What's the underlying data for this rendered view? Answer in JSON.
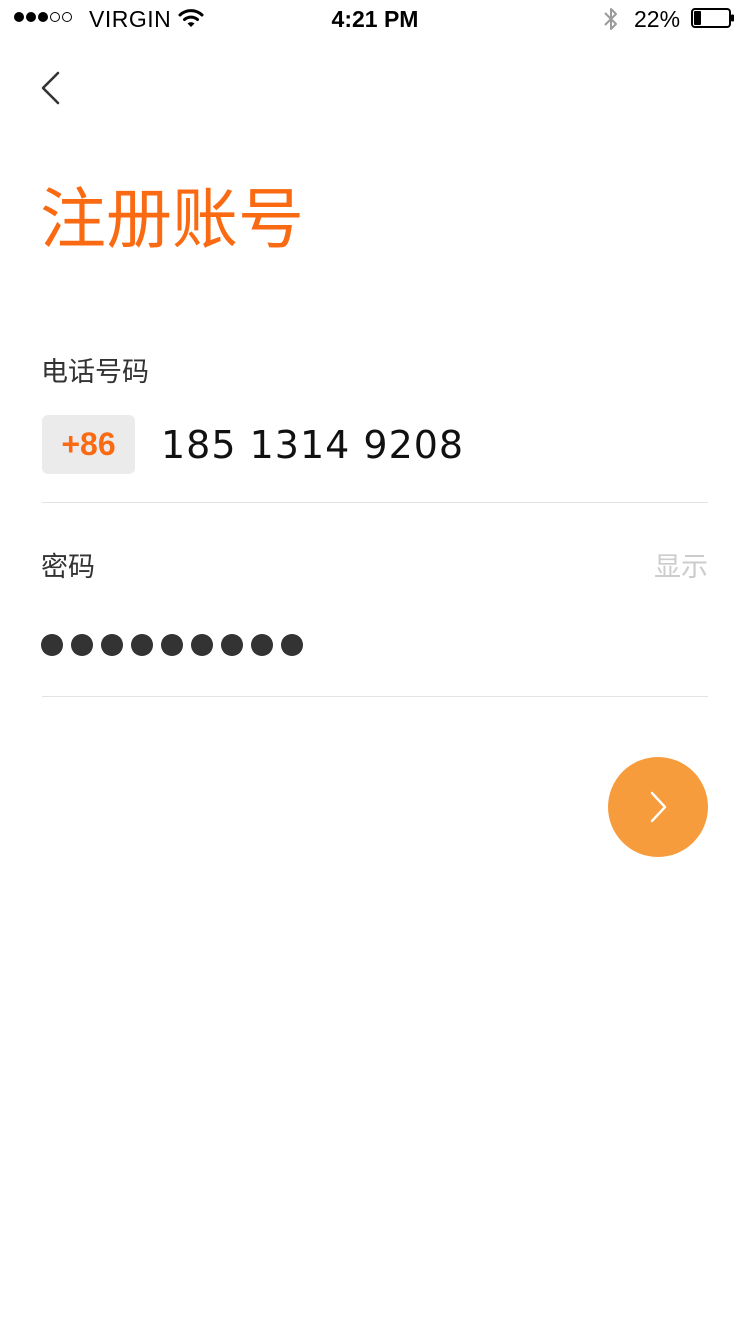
{
  "status_bar": {
    "signal_bars_filled": 3,
    "signal_bars_total": 5,
    "carrier": "VIRGIN",
    "wifi_icon": "wifi-icon",
    "time": "4:21 PM",
    "bluetooth_icon": "bluetooth-icon",
    "battery_percent": "22%",
    "battery_level": 0.22
  },
  "nav": {
    "back_icon": "chevron-left-icon"
  },
  "title": "注册账号",
  "form": {
    "phone": {
      "label": "电话号码",
      "country_code": "+86",
      "value": "185 1314 9208"
    },
    "password": {
      "label": "密码",
      "show_label": "显示",
      "masked_length": 9
    }
  },
  "next_button": {
    "icon": "chevron-right-icon"
  },
  "colors": {
    "accent": "#fa6a12",
    "button": "#f79c3c",
    "muted": "#cccccc",
    "divider": "#e3e3e3",
    "code_bg": "#ebebeb"
  }
}
